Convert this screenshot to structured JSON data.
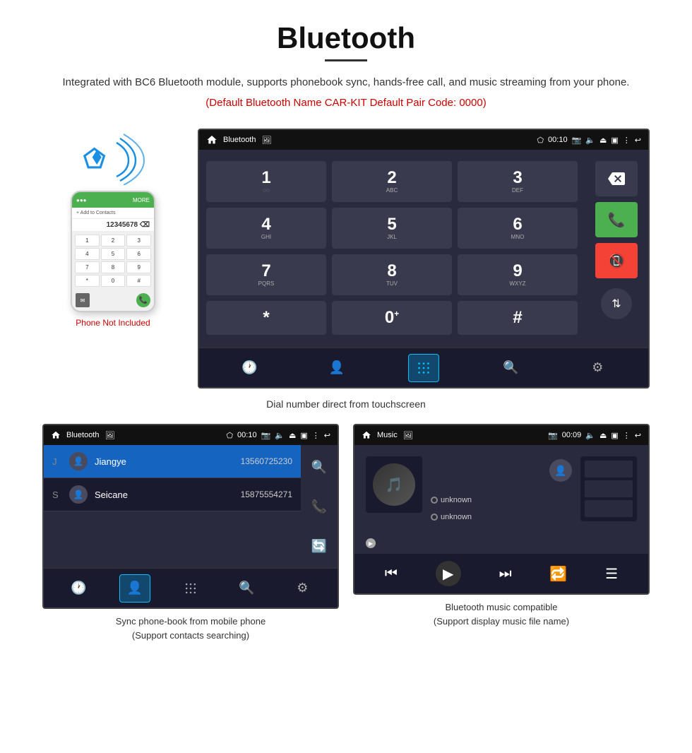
{
  "page": {
    "title": "Bluetooth",
    "description": "Integrated with BC6 Bluetooth module, supports phonebook sync, hands-free call, and music streaming from your phone.",
    "bt_info": "(Default Bluetooth Name CAR-KIT    Default Pair Code: 0000)"
  },
  "phone_col": {
    "not_included": "Phone Not Included"
  },
  "dial_screen": {
    "status_bar": {
      "title": "Bluetooth",
      "time": "00:10"
    },
    "keys": [
      {
        "num": "1",
        "sub": "◌◌"
      },
      {
        "num": "2",
        "sub": "ABC"
      },
      {
        "num": "3",
        "sub": "DEF"
      },
      {
        "num": "4",
        "sub": "GHI"
      },
      {
        "num": "5",
        "sub": "JKL"
      },
      {
        "num": "6",
        "sub": "MNO"
      },
      {
        "num": "7",
        "sub": "PQRS"
      },
      {
        "num": "8",
        "sub": "TUV"
      },
      {
        "num": "9",
        "sub": "WXYZ"
      },
      {
        "num": "*",
        "sub": ""
      },
      {
        "num": "0",
        "sub": "+"
      },
      {
        "num": "#",
        "sub": ""
      }
    ],
    "caption": "Dial number direct from touchscreen"
  },
  "contacts_screen": {
    "status_bar": {
      "title": "Bluetooth",
      "time": "00:10"
    },
    "contacts": [
      {
        "letter": "J",
        "name": "Jiangye",
        "number": "13560725230",
        "highlighted": true
      },
      {
        "letter": "S",
        "name": "Seicane",
        "number": "15875554271",
        "highlighted": false
      }
    ],
    "caption_line1": "Sync phone-book from mobile phone",
    "caption_line2": "(Support contacts searching)"
  },
  "music_screen": {
    "status_bar": {
      "title": "Music",
      "time": "00:09"
    },
    "track_info": [
      {
        "label": "unknown"
      },
      {
        "label": "unknown"
      }
    ],
    "caption_line1": "Bluetooth music compatible",
    "caption_line2": "(Support display music file name)"
  }
}
